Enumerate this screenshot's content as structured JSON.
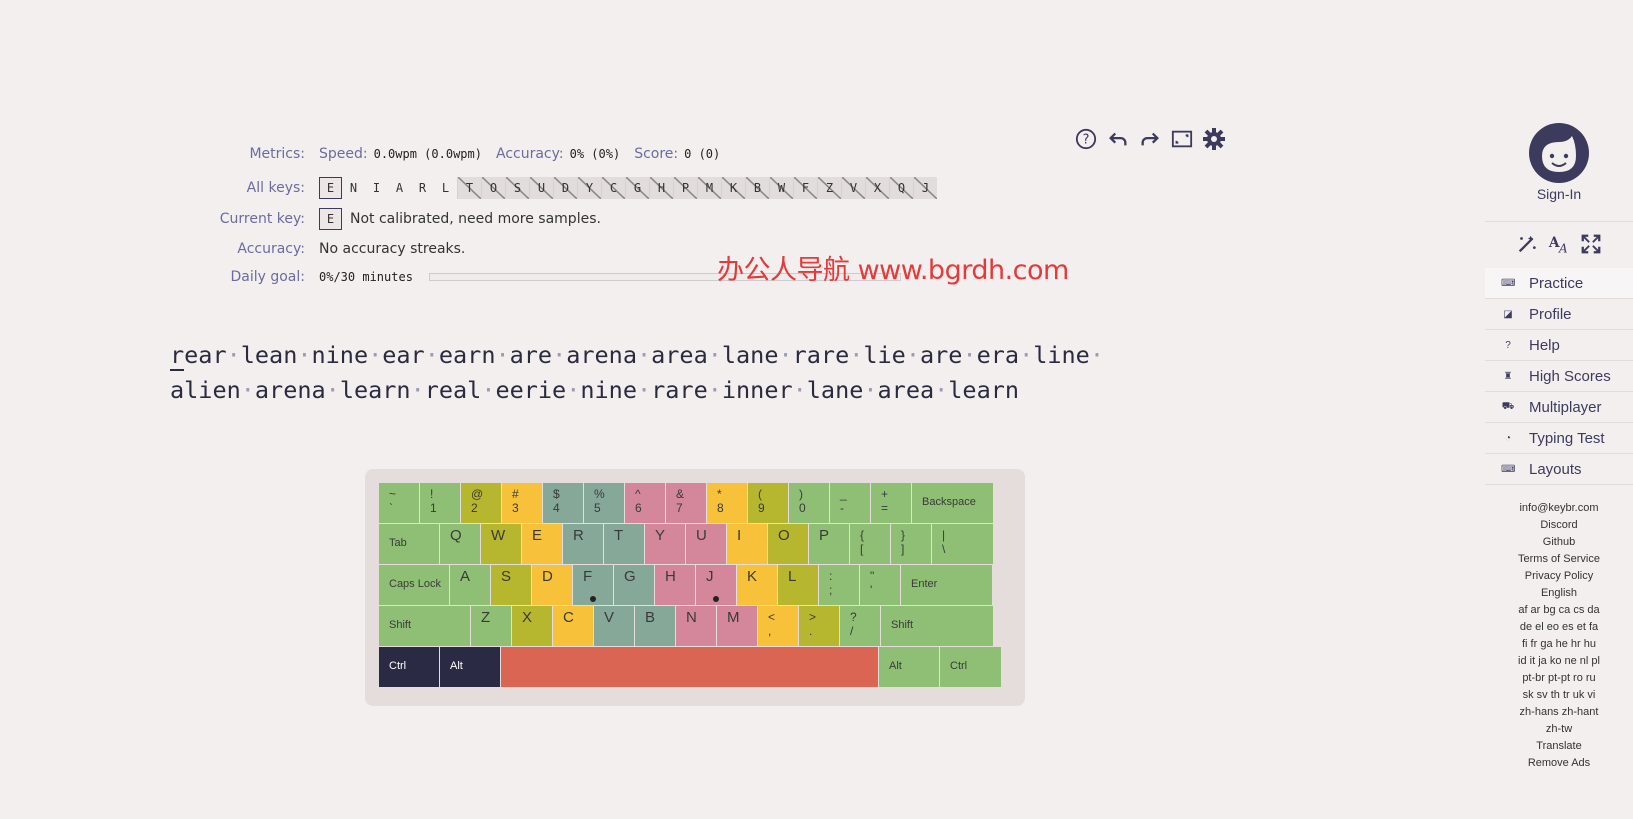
{
  "metrics": {
    "label": "Metrics:",
    "speed_label": "Speed:",
    "speed_value": "0.0wpm (0.0wpm)",
    "accuracy_label": "Accuracy:",
    "accuracy_value": "0% (0%)",
    "score_label": "Score:",
    "score_value": "0 (0)"
  },
  "all_keys": {
    "label": "All keys:",
    "keys": [
      "E",
      "N",
      "I",
      "A",
      "R",
      "L",
      "T",
      "O",
      "S",
      "U",
      "D",
      "Y",
      "C",
      "G",
      "H",
      "P",
      "M",
      "K",
      "B",
      "W",
      "F",
      "Z",
      "V",
      "X",
      "Q",
      "J"
    ],
    "unlocked_count": 6
  },
  "current_key": {
    "label": "Current key:",
    "key": "E",
    "status": "Not calibrated, need more samples."
  },
  "accuracy_row": {
    "label": "Accuracy:",
    "value": "No accuracy streaks."
  },
  "daily_goal": {
    "label": "Daily goal:",
    "value": "0%/30 minutes",
    "progress": 0
  },
  "watermark": "办公人导航 www.bgrdh.com",
  "lesson": {
    "line1": [
      "rear",
      "lean",
      "nine",
      "ear",
      "earn",
      "are",
      "arena",
      "area",
      "lane",
      "rare",
      "lie",
      "are",
      "era",
      "line"
    ],
    "line2": [
      "alien",
      "arena",
      "learn",
      "real",
      "eerie",
      "nine",
      "rare",
      "inner",
      "lane",
      "area",
      "learn"
    ]
  },
  "toolbar": {
    "icons": [
      "help-icon",
      "undo-icon",
      "redo-icon",
      "fullscreen-icon",
      "settings-icon"
    ]
  },
  "keyboard": {
    "row1": [
      {
        "top": "~",
        "bot": "`",
        "c": "g"
      },
      {
        "top": "!",
        "bot": "1",
        "c": "g"
      },
      {
        "top": "@",
        "bot": "2",
        "c": "y"
      },
      {
        "top": "#",
        "bot": "3",
        "c": "o"
      },
      {
        "top": "$",
        "bot": "4",
        "c": "t"
      },
      {
        "top": "%",
        "bot": "5",
        "c": "t"
      },
      {
        "top": "^",
        "bot": "6",
        "c": "p"
      },
      {
        "top": "&",
        "bot": "7",
        "c": "p"
      },
      {
        "top": "*",
        "bot": "8",
        "c": "o"
      },
      {
        "top": "(",
        "bot": "9",
        "c": "y"
      },
      {
        "top": ")",
        "bot": "0",
        "c": "g"
      },
      {
        "top": "_",
        "bot": "-",
        "c": "g"
      },
      {
        "top": "+",
        "bot": "=",
        "c": "g"
      }
    ],
    "backspace": "Backspace",
    "tab": "Tab",
    "row2": [
      {
        "k": "Q",
        "c": "g"
      },
      {
        "k": "W",
        "c": "y"
      },
      {
        "k": "E",
        "c": "o"
      },
      {
        "k": "R",
        "c": "t"
      },
      {
        "k": "T",
        "c": "t"
      },
      {
        "k": "Y",
        "c": "p"
      },
      {
        "k": "U",
        "c": "p"
      },
      {
        "k": "I",
        "c": "o"
      },
      {
        "k": "O",
        "c": "y"
      },
      {
        "k": "P",
        "c": "g"
      }
    ],
    "row2_extra": [
      {
        "top": "{",
        "bot": "[",
        "c": "g"
      },
      {
        "top": "}",
        "bot": "]",
        "c": "g"
      },
      {
        "top": "|",
        "bot": "\\",
        "c": "g"
      }
    ],
    "caps": "Caps Lock",
    "row3": [
      {
        "k": "A",
        "c": "g"
      },
      {
        "k": "S",
        "c": "y"
      },
      {
        "k": "D",
        "c": "o"
      },
      {
        "k": "F",
        "c": "t",
        "dot": true
      },
      {
        "k": "G",
        "c": "t"
      },
      {
        "k": "H",
        "c": "p"
      },
      {
        "k": "J",
        "c": "p",
        "dot": true
      },
      {
        "k": "K",
        "c": "o"
      },
      {
        "k": "L",
        "c": "y"
      }
    ],
    "row3_extra": [
      {
        "top": ":",
        "bot": ";",
        "c": "g"
      },
      {
        "top": "\"",
        "bot": "'",
        "c": "g"
      }
    ],
    "enter": "Enter",
    "shift": "Shift",
    "row4": [
      {
        "k": "Z",
        "c": "g"
      },
      {
        "k": "X",
        "c": "y"
      },
      {
        "k": "C",
        "c": "o"
      },
      {
        "k": "V",
        "c": "t"
      },
      {
        "k": "B",
        "c": "t"
      },
      {
        "k": "N",
        "c": "p"
      },
      {
        "k": "M",
        "c": "p"
      }
    ],
    "row4_extra": [
      {
        "top": "<",
        "bot": ",",
        "c": "o"
      },
      {
        "top": ">",
        "bot": ".",
        "c": "y"
      },
      {
        "top": "?",
        "bot": "/",
        "c": "g"
      }
    ],
    "ctrl": "Ctrl",
    "alt": "Alt",
    "colors": {
      "g": "#8fbf74",
      "y": "#b7b72f",
      "o": "#f7c23a",
      "t": "#86a899",
      "p": "#d4879b",
      "dark": "#2a2a44",
      "space": "#d96552"
    }
  },
  "sidebar": {
    "signin": "Sign-In",
    "nav": [
      {
        "label": "Practice",
        "icon": "keyboard-icon"
      },
      {
        "label": "Profile",
        "icon": "chart-icon"
      },
      {
        "label": "Help",
        "icon": "help-icon"
      },
      {
        "label": "High Scores",
        "icon": "trophy-icon"
      },
      {
        "label": "Multiplayer",
        "icon": "car-icon"
      },
      {
        "label": "Typing Test",
        "icon": "speedometer-icon"
      },
      {
        "label": "Layouts",
        "icon": "keyboard-icon"
      }
    ],
    "links": [
      "info@keybr.com",
      "Discord",
      "Github",
      "Terms of Service",
      "Privacy Policy",
      "English",
      "af ar bg ca cs da",
      "de el eo es et fa",
      "fi fr ga he hr hu",
      "id it ja ko ne nl pl",
      "pt-br pt-pt ro ru",
      "sk sv th tr uk vi",
      "zh-hans zh-hant",
      "zh-tw",
      "Translate",
      "Remove Ads"
    ]
  }
}
